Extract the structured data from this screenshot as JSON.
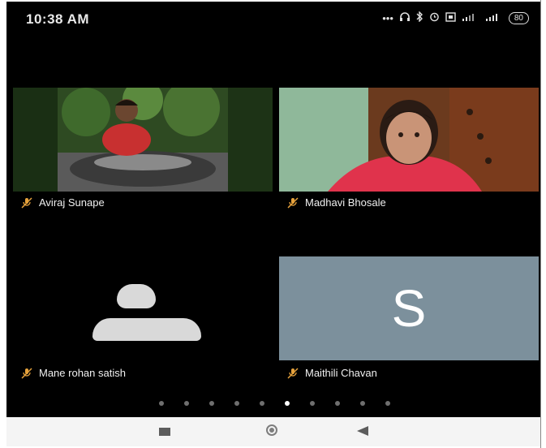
{
  "status_bar": {
    "time": "10:38 AM",
    "icons": [
      "dots-icon",
      "headphones-icon",
      "bluetooth-icon",
      "alarm-icon",
      "sim-icon",
      "signal-icon",
      "signal-icon",
      "battery-icon"
    ],
    "battery": "80"
  },
  "participants": [
    {
      "name": "Aviraj Sunape",
      "muted": true,
      "video": "photo"
    },
    {
      "name": "Madhavi Bhosale",
      "muted": true,
      "video": "photo"
    },
    {
      "name": "Mane rohan satish",
      "muted": true,
      "video": "avatar"
    },
    {
      "name": "Maithili Chavan",
      "muted": true,
      "video": "initial",
      "initial": "S",
      "tile_color": "#7c909c"
    }
  ],
  "pagination": {
    "pages": 10,
    "active": 5
  },
  "nav_bar": {
    "buttons": [
      "recent-apps",
      "home",
      "back"
    ]
  }
}
